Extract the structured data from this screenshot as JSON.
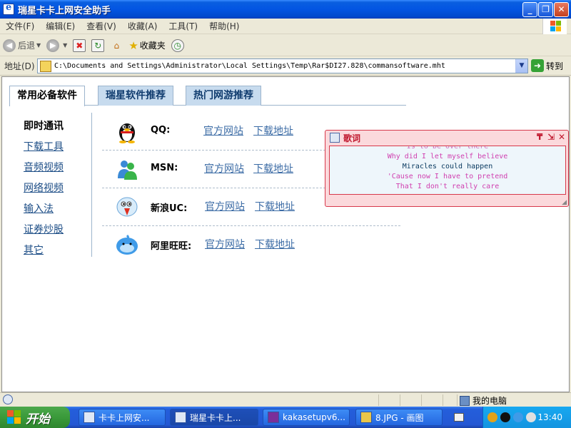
{
  "window": {
    "title": "瑞星卡卡上网安全助手",
    "controls": {
      "minimize": "_",
      "restore": "❐",
      "close": "✕"
    }
  },
  "menubar": {
    "items": [
      "文件(F)",
      "编辑(E)",
      "查看(V)",
      "收藏(A)",
      "工具(T)",
      "帮助(H)"
    ]
  },
  "toolbar": {
    "back_label": "后退",
    "favorites_label": "收藏夹"
  },
  "addressbar": {
    "label": "地址(D)",
    "url": "C:\\Documents and Settings\\Administrator\\Local Settings\\Temp\\Rar$DI27.828\\commansoftware.mht",
    "go_label": "转到"
  },
  "page": {
    "tabs": [
      {
        "label": "常用必备软件",
        "active": true
      },
      {
        "label": "瑞星软件推荐",
        "active": false
      },
      {
        "label": "热门网游推荐",
        "active": false
      }
    ],
    "sidenav": [
      {
        "label": "即时通讯",
        "active": true
      },
      {
        "label": "下载工具",
        "active": false
      },
      {
        "label": "音频视频",
        "active": false
      },
      {
        "label": "网络视频",
        "active": false
      },
      {
        "label": "输入法",
        "active": false
      },
      {
        "label": "证券炒股",
        "active": false
      },
      {
        "label": "其它",
        "active": false
      }
    ],
    "software": [
      {
        "name": "QQ:",
        "icon": "qq-penguin-icon",
        "official": "官方网站",
        "download": "下载地址"
      },
      {
        "name": "MSN:",
        "icon": "msn-buddy-icon",
        "official": "官方网站",
        "download": "下载地址"
      },
      {
        "name": "新浪UC:",
        "icon": "sina-uc-bird-icon",
        "official": "官方网站",
        "download": "下载地址"
      },
      {
        "name": "阿里旺旺:",
        "icon": "aliwangwang-icon",
        "official": "官方网站",
        "download": "下载地址"
      }
    ]
  },
  "lyrics": {
    "title": "歌词",
    "controls": {
      "pin": "₸",
      "shrink": "⇲",
      "close": "✕"
    },
    "lines": [
      {
        "text": "Is to be over there",
        "color": "#d070c0"
      },
      {
        "text": "Why did I let myself believe",
        "color": "#d040b0"
      },
      {
        "text": "Miracles could happen",
        "color": "#0a3a60"
      },
      {
        "text": "'Cause now I have to pretend",
        "color": "#d040b0"
      },
      {
        "text": "That I don't really care",
        "color": "#d040b0"
      }
    ]
  },
  "statusbar": {
    "zone_label": "我的电脑"
  },
  "taskbar": {
    "start_label": "开始",
    "buttons": [
      {
        "label": "卡卡上网安..."
      },
      {
        "label": "瑞星卡卡上..."
      },
      {
        "label": "kakasetupv6..."
      },
      {
        "label": "8.JPG - 画图"
      }
    ],
    "clock": "13:40"
  }
}
